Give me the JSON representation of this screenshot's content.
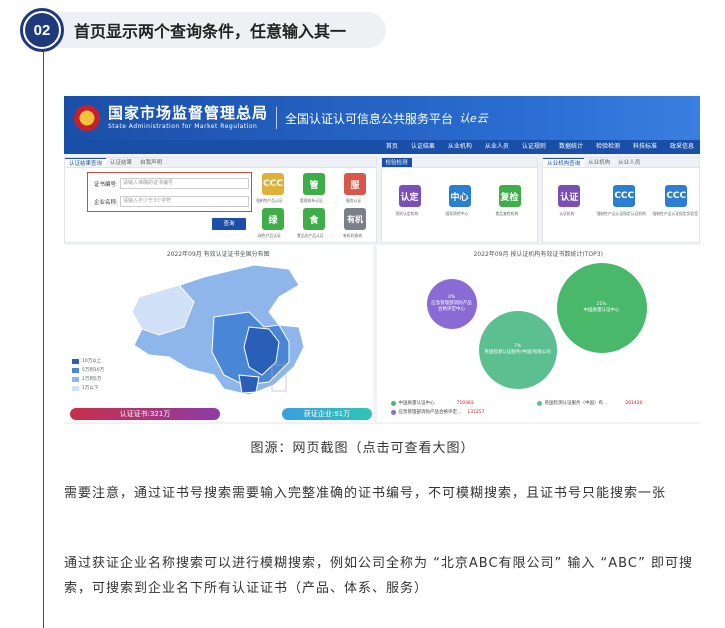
{
  "section": {
    "number": "02",
    "title": "首页显示两个查询条件，任意输入其一"
  },
  "screenshot": {
    "header": {
      "org_cn": "国家市场监督管理总局",
      "org_en": "State Administration for Market Regulation",
      "platform": "全国认证认可信息公共服务平台",
      "logo_text": "认e云"
    },
    "nav": [
      "首页",
      "认证结果",
      "从业机构",
      "从业人员",
      "认证规则",
      "数据统计",
      "检验检测",
      "科技标准",
      "政采信息"
    ],
    "query_panel": {
      "tabs": [
        "认证结果查询",
        "认证结果",
        "自我声明"
      ],
      "cert_no_label": "证书编号:",
      "cert_no_placeholder": "请输入准确的证书编号",
      "company_label": "企业名称:",
      "company_placeholder": "请输入不少于3个字符",
      "query_button": "查询",
      "tiles": [
        {
          "icon": "CCC",
          "label": "强制性产品认证",
          "color": "#e0b13a"
        },
        {
          "icon": "管",
          "label": "管理体系认证",
          "color": "#3fae49"
        },
        {
          "icon": "服",
          "label": "服务认证",
          "color": "#d8574a"
        },
        {
          "icon": "绿",
          "label": "绿色产品认证",
          "color": "#3fae49"
        },
        {
          "icon": "食",
          "label": "食品农产品认证",
          "color": "#3fae49"
        },
        {
          "icon": "有机",
          "label": "有机码查询",
          "color": "#7a7f8a"
        }
      ]
    },
    "inspection_panel": {
      "title": "检验检测",
      "tiles": [
        {
          "icon": "认定",
          "label": "资质认定机构",
          "color": "#7a4fb8"
        },
        {
          "icon": "中心",
          "label": "国家质检中心",
          "color": "#2a7fd0"
        },
        {
          "icon": "复检",
          "label": "食品复检机构",
          "color": "#3fae49"
        }
      ]
    },
    "org_panel": {
      "tabs": [
        "从业机构查询",
        "从业机构",
        "从业人员"
      ],
      "tiles": [
        {
          "icon": "认证",
          "label": "认证机构",
          "color": "#7a4fb8"
        },
        {
          "icon": "CCC",
          "label": "强制性产品认证指定认证机构",
          "color": "#2a7fd0"
        },
        {
          "icon": "CCC",
          "label": "强制性产品认证指定实验室",
          "color": "#2a7fd0"
        }
      ]
    },
    "map_chart": {
      "title": "2022年09月 有效认证证书全国分布图",
      "legend": [
        {
          "label": "10万以上",
          "color": "#2a5fb8"
        },
        {
          "label": "5万到10万",
          "color": "#4a86d6"
        },
        {
          "label": "1万到5万",
          "color": "#8fb6ea"
        },
        {
          "label": "1万以下",
          "color": "#cfe0f7"
        }
      ],
      "cert_total": "认证证书:321万",
      "company_total": "获证企业:91万"
    },
    "bubble_chart": {
      "title": "2022年09月 按认证机构有效证书数统计(TOP3)",
      "bubbles": [
        {
          "pct": "4%",
          "name": "应急管理部消防产品合格评定中心",
          "color": "#8a6bd6"
        },
        {
          "pct": "7%",
          "name": "英国检测认证服务(中国)有限公司",
          "color": "#5bbf90"
        },
        {
          "pct": "21%",
          "name": "中国质量认证中心",
          "color": "#49b86a"
        }
      ],
      "legend": [
        {
          "name": "中国质量认证中心",
          "value": "710363",
          "color": "#49b86a"
        },
        {
          "name": "英国检测认证服务（中国）有...",
          "value": "261420",
          "color": "#5bbf90"
        },
        {
          "name": "应急管理部消防产品合格评定...",
          "value": "137257",
          "color": "#8a6bd6"
        }
      ]
    }
  },
  "caption": "图源：网页截图（点击可查看大图）",
  "paragraphs": [
    "需要注意，通过证书号搜索需要输入完整准确的证书编号，不可模糊搜索，且证书号只能搜索一张",
    "通过获证企业名称搜索可以进行模糊搜索，例如公司全称为 “北京ABC有限公司” 输入 “ABC” 即可搜索，可搜索到企业名下所有认证证书（产品、体系、服务）"
  ]
}
